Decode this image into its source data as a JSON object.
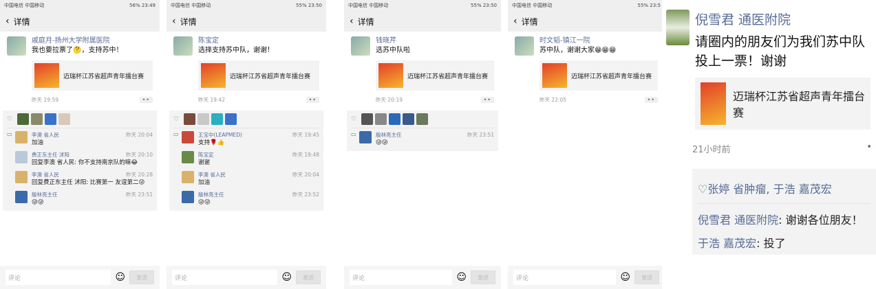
{
  "panels": [
    {
      "status": {
        "left": "中国电信 中国移动",
        "right": "56% 23:49"
      },
      "title": "详情",
      "post": {
        "author": "戚庭月-扬州大学附属医院",
        "text": "我也要拉票了🤔，支持苏中！",
        "share_title": "迈瑞杯江苏省超声青年擂台赛",
        "time": "昨天 19:59",
        "more": "••"
      },
      "like_avatars": [
        "#4a6a3a",
        "#8a8a6a",
        "#3a72c9",
        "#d9c9b9"
      ],
      "comments": [
        {
          "name": "李澳 省人民",
          "time": "昨天 20:04",
          "text": "加油",
          "av": "#d8b26a"
        },
        {
          "name": "费正东主任 沭阳",
          "time": "昨天 20:10",
          "text": "回复李澳 省人民: 你不支持南京队的嘛😂",
          "av": "#b9c9d9"
        },
        {
          "name": "李澳 省人民",
          "time": "昨天 20:28",
          "text": "回复费正东主任 沭阳: 比赛第一 友谊第二😜",
          "av": "#d8b26a"
        },
        {
          "name": "殷林亮主任",
          "time": "昨天 23:51",
          "text": "😜😜",
          "av": "#3a6aa9"
        }
      ],
      "comment_placeholder": "评论",
      "send_label": "发送"
    },
    {
      "status": {
        "left": "中国电信 中国移动",
        "right": "55% 23:50"
      },
      "title": "详情",
      "post": {
        "author": "陈宝定",
        "text": "选择支持苏中队，谢谢！",
        "share_title": "迈瑞杯江苏省超声青年擂台赛",
        "time": "昨天 19:42",
        "more": "••"
      },
      "like_avatars": [
        "#7a4a3a",
        "#c9c9c9",
        "#2ab0c0",
        "#3a72c9"
      ],
      "comments": [
        {
          "name": "王宝中(LEAPMED)",
          "time": "昨天 19:45",
          "text": "支持🌹👍",
          "av": "#c94a3a"
        },
        {
          "name": "陈宝定",
          "time": "昨天 19:48",
          "text": "谢谢",
          "av": "#6a8a4a"
        },
        {
          "name": "李澳 省人民",
          "time": "昨天 20:04",
          "text": "加油",
          "av": "#d8b26a"
        },
        {
          "name": "殷林亮主任",
          "time": "昨天 23:52",
          "text": "😜😜",
          "av": "#3a6aa9"
        }
      ],
      "comment_placeholder": "评论",
      "send_label": "发送"
    },
    {
      "status": {
        "left": "中国电信 中国移动",
        "right": "55% 23:50"
      },
      "title": "详情",
      "post": {
        "author": "钱晓芹",
        "text": "选苏中队啦",
        "share_title": "迈瑞杯江苏省超声青年擂台赛",
        "time": "昨天 20:19",
        "more": "••"
      },
      "like_avatars": [
        "#555555",
        "#888888",
        "#2a6ab9",
        "#3a5a8a",
        "#6a7a5a"
      ],
      "comments": [
        {
          "name": "殷林亮主任",
          "time": "昨天 23:51",
          "text": "😜😜",
          "av": "#3a6aa9"
        }
      ],
      "comment_placeholder": "评论",
      "send_label": "发送"
    },
    {
      "status": {
        "left": "中国电信 中国移动",
        "right": "55% 23:5"
      },
      "title": "详情",
      "post": {
        "author": "时文韬-镇江一院",
        "text": "苏中队，谢谢大家😁😁😁",
        "share_title": "迈瑞杯江苏省超声青年擂台赛",
        "time": "昨天 22:05",
        "more": "••"
      },
      "like_avatars": [],
      "comments": [],
      "comment_placeholder": "评论",
      "send_label": "发送"
    }
  ],
  "zoom": {
    "author": "倪雪君 通医附院",
    "text": "请圈内的朋友们为我们苏中队投上一票！谢谢",
    "share_title": "迈瑞杯江苏省超声青年擂台赛",
    "time": "21小时前",
    "likes": "♡张婷 省肿瘤, 于浩 嘉茂宏",
    "comments": [
      {
        "name": "倪雪君 通医附院",
        "text": "谢谢各位朋友！"
      },
      {
        "name": "于浩 嘉茂宏",
        "text": "投了"
      }
    ]
  }
}
